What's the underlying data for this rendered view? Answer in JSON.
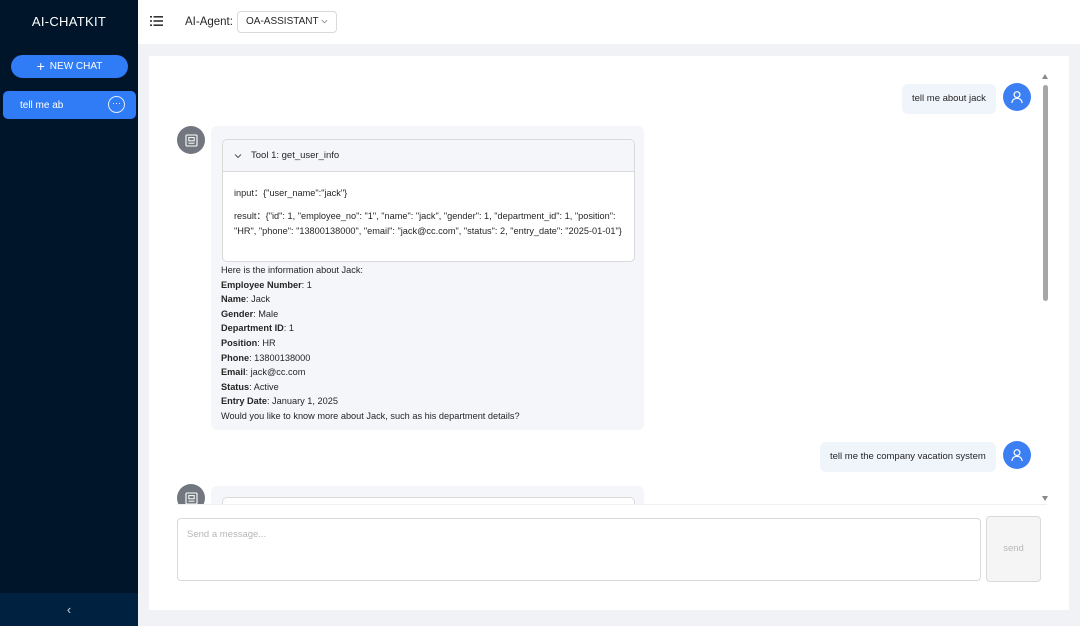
{
  "sidebar": {
    "brand": "AI-CHATKIT",
    "new_chat": {
      "icon": "plus-icon",
      "label": "NEW CHAT"
    },
    "sessions": [
      {
        "label": "tell me ab",
        "more_icon": "ellipsis-icon"
      }
    ],
    "collapse_icon": "‹"
  },
  "header": {
    "menu_icon": "menu-icon",
    "agent_label": "AI-Agent:",
    "agent_value": "OA-ASSISTANT"
  },
  "chat": {
    "messages": [
      {
        "role": "user",
        "text": "tell me about jack"
      },
      {
        "role": "assistant",
        "tool": {
          "title": "Tool 1: get_user_info",
          "input": "input：{\"user_name\":\"jack\"}",
          "result": "result：{\"id\": 1, \"employee_no\": \"1\", \"name\": \"jack\", \"gender\": 1, \"department_id\": 1, \"position\": \"HR\", \"phone\": \"13800138000\", \"email\": \"jack@cc.com\", \"status\": 2, \"entry_date\": \"2025-01-01\"}"
        },
        "intro": "Here is the information about Jack:",
        "fields": [
          {
            "label": "Employee Number",
            "value": ": 1"
          },
          {
            "label": "Name",
            "value": ": Jack"
          },
          {
            "label": "Gender",
            "value": ": Male"
          },
          {
            "label": "Department ID",
            "value": ": 1"
          },
          {
            "label": "Position",
            "value": ": HR"
          },
          {
            "label": "Phone",
            "value": ": 13800138000"
          },
          {
            "label": "Email",
            "value": ": jack@cc.com"
          },
          {
            "label": "Status",
            "value": ": Active"
          },
          {
            "label": "Entry Date",
            "value": ": January 1, 2025"
          }
        ],
        "outro": "Would you like to know more about Jack, such as his department details?"
      },
      {
        "role": "user",
        "text": "tell me the company vacation system"
      }
    ]
  },
  "composer": {
    "placeholder": "Send a message...",
    "send_label": "send"
  },
  "colors": {
    "sidebar_bg": "#001529",
    "accent": "#2f7cf6",
    "user_avatar": "#3b7ff2",
    "bot_avatar": "#72777f"
  }
}
